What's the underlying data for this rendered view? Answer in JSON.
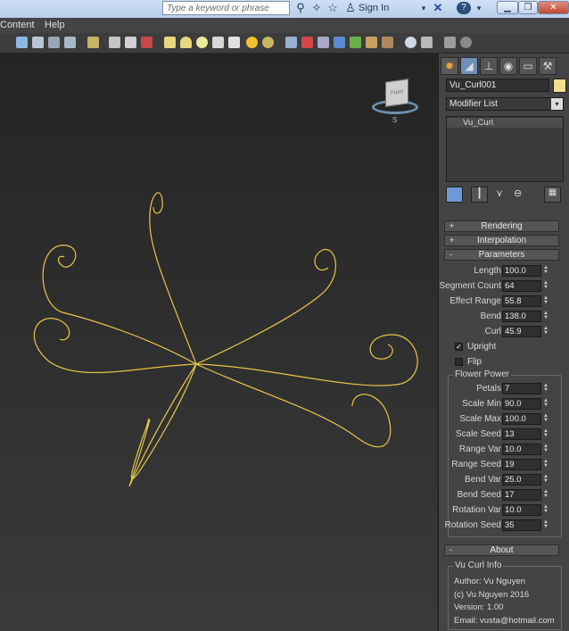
{
  "titlebar": {
    "search_placeholder": "Type a keyword or phrase",
    "signin_label": "Sign In",
    "icons": [
      "binoculars-icon",
      "star-plus-icon",
      "star-icon",
      "user-icon",
      "x-icon",
      "help-icon"
    ],
    "window_buttons": [
      "minimize",
      "restore",
      "close"
    ]
  },
  "menubar": {
    "items": [
      "Content",
      "Help"
    ]
  },
  "viewport": {
    "curve_color": "#e8c54a",
    "viewcube_label": "Front"
  },
  "panel": {
    "tabs": [
      "create-tab",
      "modify-tab",
      "hierarchy-tab",
      "motion-tab",
      "display-tab",
      "utilities-tab"
    ],
    "object_name": "Vu_Curl001",
    "object_color": "#f3dd8f",
    "modifier_list_label": "Modifier List",
    "stack_item": "Vu_Curl",
    "rollouts": {
      "rendering": "Rendering",
      "interpolation": "Interpolation",
      "parameters": "Parameters",
      "about": "About"
    },
    "params": [
      {
        "label": "Length",
        "value": "100.0"
      },
      {
        "label": "Segment Count",
        "value": "64"
      },
      {
        "label": "Effect Range",
        "value": "55.8"
      },
      {
        "label": "Bend",
        "value": "138.0"
      },
      {
        "label": "Curl",
        "value": "45.9"
      }
    ],
    "upright_label": "Upright",
    "upright_checked": true,
    "flip_label": "Flip",
    "flip_checked": false,
    "flower_power": {
      "title": "Flower Power",
      "params": [
        {
          "label": "Petals",
          "value": "7"
        },
        {
          "label": "Scale Min",
          "value": "90.0"
        },
        {
          "label": "Scale Max",
          "value": "100.0"
        },
        {
          "label": "Scale Seed",
          "value": "13"
        },
        {
          "label": "Range Var",
          "value": "10.0"
        },
        {
          "label": "Range Seed",
          "value": "19"
        },
        {
          "label": "Bend Var",
          "value": "25.0"
        },
        {
          "label": "Bend Seed",
          "value": "17"
        },
        {
          "label": "Rotation Var",
          "value": "10.0"
        },
        {
          "label": "Rotation Seed",
          "value": "35"
        }
      ]
    },
    "about": {
      "title": "Vu Curl Info",
      "author": "Author: Vu Nguyen",
      "copyright": "(c) Vu Nguyen 2016",
      "version": "Version: 1.00",
      "email": "Email: vusta@hotmail.com"
    }
  }
}
